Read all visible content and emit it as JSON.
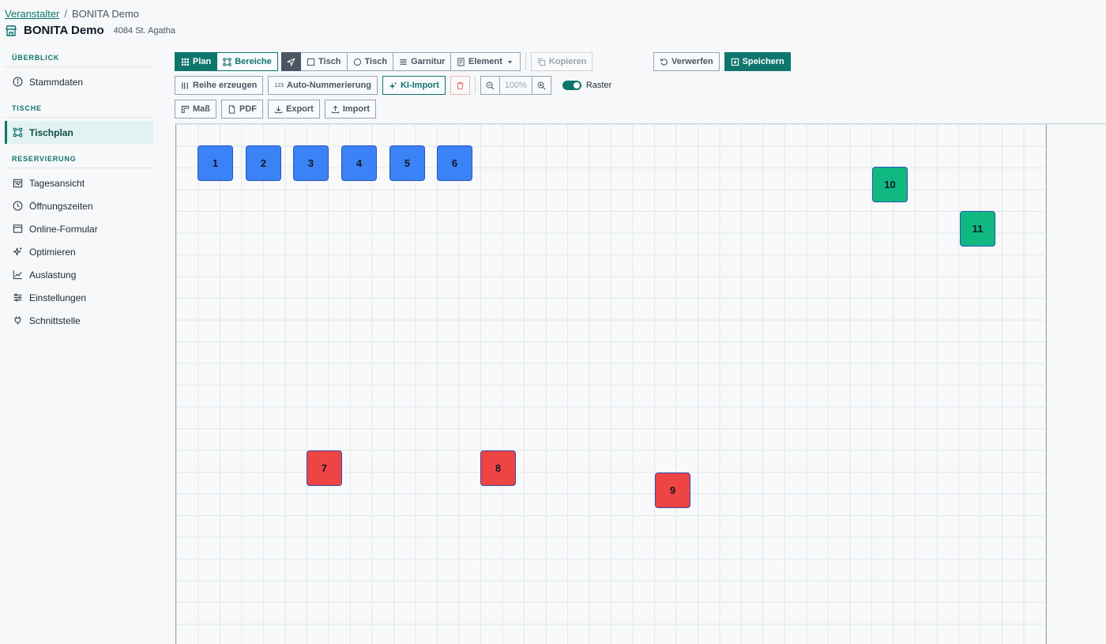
{
  "breadcrumb": {
    "parent": "Veranstalter",
    "separator": "/",
    "current": "BONITA Demo"
  },
  "venue": {
    "title": "BONITA Demo",
    "subtitle": "4084 St. Agatha"
  },
  "sidebar": {
    "sections": [
      {
        "title": "ÜBERBLICK",
        "items": [
          {
            "label": "Stammdaten",
            "icon": "info-icon"
          }
        ]
      },
      {
        "title": "TISCHE",
        "items": [
          {
            "label": "Tischplan",
            "icon": "layout-icon",
            "active": true
          }
        ]
      },
      {
        "title": "RESERVIERUNG",
        "items": [
          {
            "label": "Tagesansicht",
            "icon": "calendar-icon"
          },
          {
            "label": "Öffnungszeiten",
            "icon": "clock-icon"
          },
          {
            "label": "Online-Formular",
            "icon": "form-icon"
          },
          {
            "label": "Optimieren",
            "icon": "sparkle-icon"
          },
          {
            "label": "Auslastung",
            "icon": "chart-icon"
          },
          {
            "label": "Einstellungen",
            "icon": "sliders-icon"
          },
          {
            "label": "Schnittstelle",
            "icon": "plug-icon"
          }
        ]
      }
    ]
  },
  "toolbar": {
    "plan": "Plan",
    "bereiche": "Bereiche",
    "tisch_rect": "Tisch",
    "tisch_round": "Tisch",
    "garnitur": "Garnitur",
    "element": "Element",
    "kopieren": "Kopieren",
    "verwerfen": "Verwerfen",
    "speichern": "Speichern",
    "reihe": "Reihe erzeugen",
    "autonum_prefix": "123",
    "autonum": "Auto-Nummerierung",
    "kiimport": "KI-Import",
    "zoom": "100%",
    "raster": "Raster",
    "mass": "Maß",
    "pdf": "PDF",
    "export": "Export",
    "import": "Import"
  },
  "tables": [
    {
      "label": "1",
      "color": "blue"
    },
    {
      "label": "2",
      "color": "blue"
    },
    {
      "label": "3",
      "color": "blue"
    },
    {
      "label": "4",
      "color": "blue"
    },
    {
      "label": "5",
      "color": "blue"
    },
    {
      "label": "6",
      "color": "blue"
    },
    {
      "label": "7",
      "color": "red"
    },
    {
      "label": "8",
      "color": "red"
    },
    {
      "label": "9",
      "color": "red"
    },
    {
      "label": "10",
      "color": "green"
    },
    {
      "label": "11",
      "color": "green"
    }
  ],
  "colors": {
    "accent": "#0f766e",
    "table_blue": "#3b82f6",
    "table_red": "#ef4444",
    "table_green": "#10b981"
  }
}
